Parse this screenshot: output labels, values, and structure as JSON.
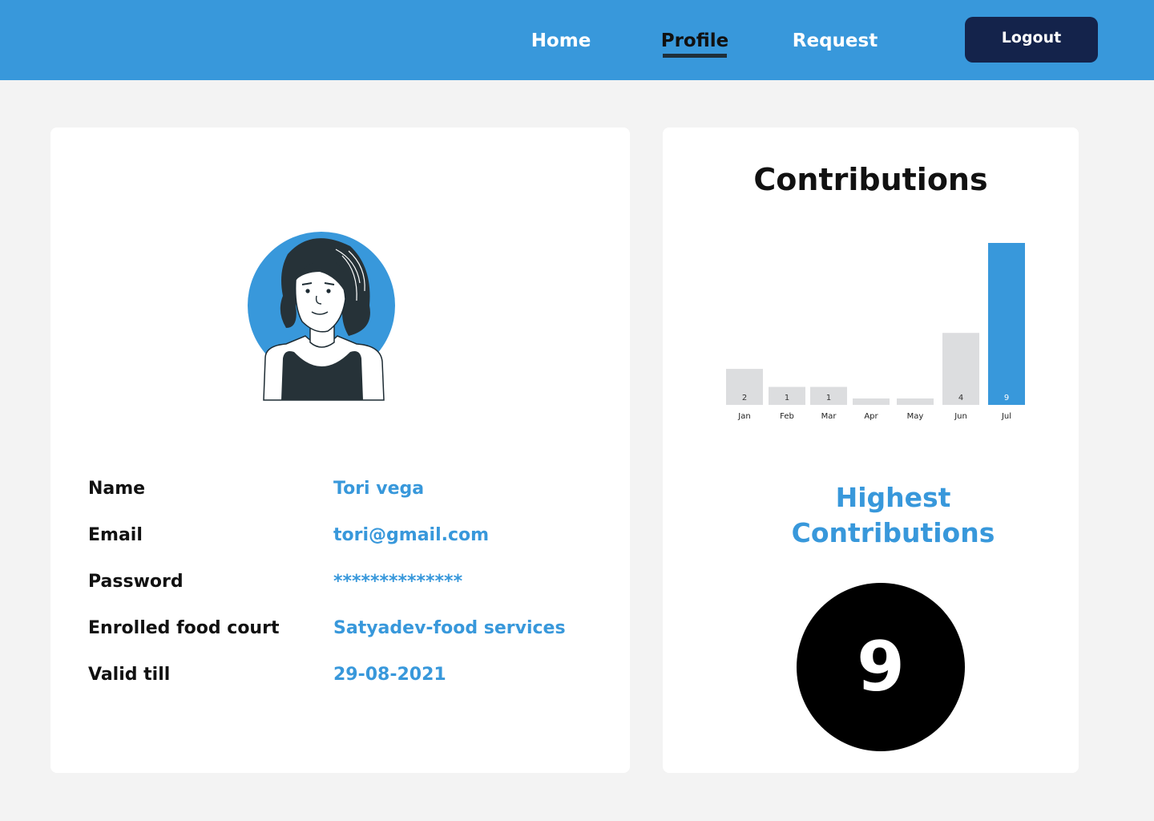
{
  "nav": {
    "home": "Home",
    "profile": "Profile",
    "request": "Request",
    "logout": "Logout",
    "active": "Profile"
  },
  "profile": {
    "fields": [
      {
        "label": "Name",
        "value": "Tori vega"
      },
      {
        "label": "Email",
        "value": "tori@gmail.com"
      },
      {
        "label": "Password",
        "value": "**************"
      },
      {
        "label": "Enrolled food court",
        "value": "Satyadev-food services"
      },
      {
        "label": "Valid till",
        "value": "29-08-2021"
      }
    ]
  },
  "contributions": {
    "title": "Contributions",
    "highest_title": "Highest Contributions",
    "highest_value": "9"
  },
  "chart_data": {
    "type": "bar",
    "categories": [
      "Jan",
      "Feb",
      "Mar",
      "Apr",
      "May",
      "Jun",
      "Jul"
    ],
    "values": [
      2,
      1,
      1,
      0,
      0,
      4,
      9
    ],
    "data_labels": [
      "2",
      "1",
      "1",
      "",
      "",
      "4",
      "9"
    ],
    "highlight_category": "Jul",
    "title": "",
    "xlabel": "",
    "ylabel": "",
    "ylim": [
      0,
      9
    ],
    "grid": false
  },
  "colors": {
    "header": "#3898db",
    "accent": "#3898db",
    "logout_button": "#14234b",
    "bar_default": "#dcdddf",
    "bar_highlight": "#3898db",
    "text_dark": "#111111"
  }
}
